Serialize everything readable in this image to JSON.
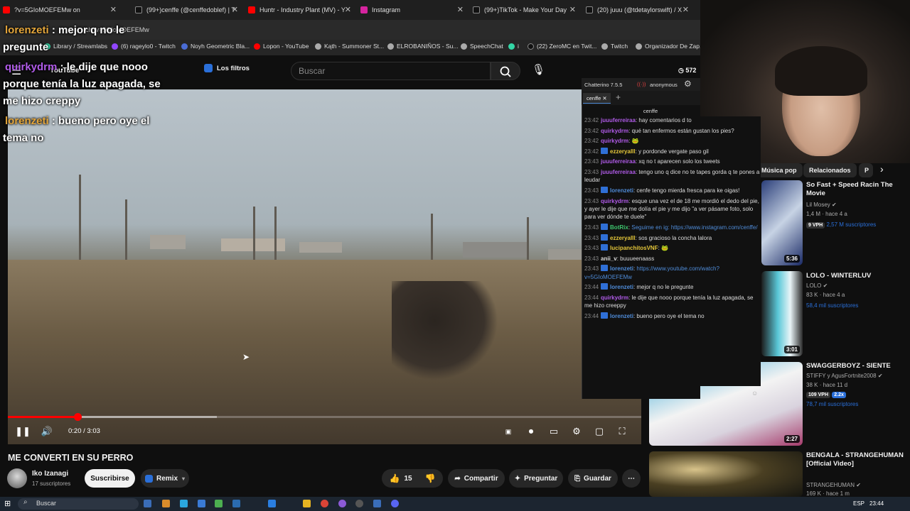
{
  "browser": {
    "tabs": [
      {
        "label": "?v=5GIoMOEFEMw on",
        "icon_color": "#ff0000"
      },
      {
        "label": "(99+)cenffe (@cenffedoblef) | T",
        "icon_color": "#111111"
      },
      {
        "label": "Huntr - Industry Plant (MV) - Y",
        "icon_color": "#ff0000"
      },
      {
        "label": "Instagram",
        "icon_color": "#d6249f"
      },
      {
        "label": "(99+)TikTok - Make Your Day",
        "icon_color": "#111111"
      },
      {
        "label": "(20) juuu (@tdetaylorswift) / X",
        "icon_color": "#111111"
      }
    ],
    "url": "ch?v=5GIoMOEFEMw",
    "bookmarks": [
      {
        "label": "Library / Streamlabs",
        "icon_color": "#33d6a6"
      },
      {
        "label": "(6) rageylo0 - Twitch",
        "icon_color": "#9146ff"
      },
      {
        "label": "Noyh Geometric Bla...",
        "icon_color": "#4a6cd4"
      },
      {
        "label": "Lopon - YouTube",
        "icon_color": "#ff0000"
      },
      {
        "label": "Kąth - Summoner St...",
        "icon_color": "#aaaaaa"
      },
      {
        "label": "ELROBANIÑOS - Su...",
        "icon_color": "#aaaaaa"
      },
      {
        "label": "SpeechChat",
        "icon_color": "#aaaaaa"
      },
      {
        "label": "i",
        "icon_color": "#33d6a6"
      },
      {
        "label": "(22) ZeroMC en Twit...",
        "icon_color": "#111111"
      },
      {
        "label": "Twitch",
        "icon_color": "#aaaaaa"
      },
      {
        "label": "Organizador De Zap...",
        "icon_color": "#aaaaaa"
      }
    ]
  },
  "overlay_chat": [
    {
      "user": "lorenzeti",
      "user_color": "#e3a53a",
      "text": ": mejor q no le"
    },
    {
      "user": "",
      "user_color": "#ffffff",
      "text": "pregunte"
    },
    {
      "user": "quirkydrm",
      "user_color": "#b05be8",
      "text": ": le dije que nooo"
    },
    {
      "user": "",
      "user_color": "#ffffff",
      "text": "porque tenía la luz apagada, se"
    },
    {
      "user": "",
      "user_color": "#ffffff",
      "text": "me hizo creppy"
    },
    {
      "user": "lorenzeti",
      "user_color": "#e3a53a",
      "text": ": bueno pero oye el"
    },
    {
      "user": "",
      "user_color": "#ffffff",
      "text": "tema no"
    }
  ],
  "youtube": {
    "logo_text": "YouTube",
    "filters_label": "Los filtros",
    "search_placeholder": "Buscar",
    "viewer_count": "572",
    "video": {
      "time": "0:20 / 3:03",
      "progress": 0.11,
      "buffered": 0.33
    },
    "title": "ME CONVERTI EN SU PERRO",
    "channel": "Iko Izanagi",
    "subs": "17 suscriptores",
    "subscribe_label": "Suscribirse",
    "remix_label": "Remix",
    "likes": "15",
    "share_label": "Compartir",
    "ask_label": "Preguntar",
    "save_label": "Guardar"
  },
  "chatterino": {
    "version": "Chatterino 7.5.5",
    "user": "anonymous",
    "tab": "cenffe",
    "channel": "cenffe",
    "messages": [
      {
        "time": "23:42",
        "user": "juuuferreiraa",
        "color": "#b05be8",
        "text": "hay comentarios d to",
        "badge": false
      },
      {
        "time": "23:42",
        "user": "quirkydrm",
        "color": "#b05be8",
        "text": "qué tan enfermos están gustan los pies?",
        "badge": false
      },
      {
        "time": "23:42",
        "user": "quirkydrm",
        "color": "#b05be8",
        "text": "🐸",
        "badge": false
      },
      {
        "time": "23:42",
        "user": "ezzeryalll",
        "color": "#e5c73a",
        "text": "y pordonde vergate paso gil",
        "badge": true
      },
      {
        "time": "23:43",
        "user": "juuuferreiraa",
        "color": "#b05be8",
        "text": "xq no t aparecen solo los tweets",
        "badge": false
      },
      {
        "time": "23:43",
        "user": "juuuferreiraa",
        "color": "#b05be8",
        "text": "tengo uno q dice no te tapes gorda q te pones a leudar",
        "badge": false
      },
      {
        "time": "23:43",
        "user": "lorenzeti",
        "color": "#4f8cd9",
        "text": "cenfe tengo mierda fresca para ke oigas!",
        "badge": true
      },
      {
        "time": "23:43",
        "user": "quirkydrm",
        "color": "#b05be8",
        "text": "esque una vez el de 18 me mordió el dedo del pie, y ayer le dije que me dolía el pie y me dijo \"a ver pásame foto, solo para ver dónde te duele\"",
        "badge": false
      },
      {
        "time": "23:43",
        "user": "BotRix",
        "color": "#3ec46d",
        "text": "Seguime en ig: https://www.instagram.com/cenffe/",
        "badge": true
      },
      {
        "time": "23:43",
        "user": "ezzeryalll",
        "color": "#e5c73a",
        "text": "sos gracioso la concha lalora",
        "badge": true
      },
      {
        "time": "23:43",
        "user": "lucipanchitosVNF",
        "color": "#e5c73a",
        "text": "🐸",
        "badge": true
      },
      {
        "time": "23:43",
        "user": "anii_v",
        "color": "#dddddd",
        "text": "buuueenaass",
        "badge": false
      },
      {
        "time": "23:43",
        "user": "lorenzeti",
        "color": "#4f8cd9",
        "text": "https://www.youtube.com/watch?v=5GIoMOEFEMw",
        "badge": true
      },
      {
        "time": "23:44",
        "user": "lorenzeti",
        "color": "#4f8cd9",
        "text": "mejor q no le pregunte",
        "badge": true
      },
      {
        "time": "23:44",
        "user": "quirkydrm",
        "color": "#b05be8",
        "text": "le dije que nooo porque tenía la luz apagada, se me hizo creeppy",
        "badge": false
      },
      {
        "time": "23:44",
        "user": "lorenzeti",
        "color": "#4f8cd9",
        "text": "bueno pero oye el tema no",
        "badge": true
      }
    ]
  },
  "recs": {
    "chips": [
      "Música pop",
      "Relacionados",
      "P"
    ],
    "items": [
      {
        "title": "So Fast + Speed Racin The Movie",
        "channel": "Lil Mosey",
        "views": "1,4 M",
        "ago": "hace 4 a",
        "vph": "9 VPH",
        "vph2": "2,57 M suscriptores",
        "duration": "5:36"
      },
      {
        "title": "LOLO - WINTERLUV",
        "channel": "LOLO",
        "views": "83 K",
        "ago": "hace 4 a",
        "vph": "",
        "vph2": "58,4 mil suscriptores",
        "duration": "3:01"
      },
      {
        "title": "SWAGGERBOYZ - SIENTE",
        "channel": "STIFFY y AgusFortnite2008",
        "views": "38 K",
        "ago": "hace 11 d",
        "vph": "109 VPH",
        "vph2b": "2.2x",
        "vph2": "78,7 mil suscriptores",
        "duration": "2:27"
      },
      {
        "title": "BENGALA - STRANGEHUMAN [Official Video]",
        "channel": "STRANGEHUMAN",
        "views": "169 K",
        "ago": "hace 1 m",
        "vph": "",
        "vph2": "",
        "duration": ""
      }
    ]
  },
  "taskbar": {
    "search": "Buscar",
    "lang": "ESP",
    "clock": "23:44"
  }
}
